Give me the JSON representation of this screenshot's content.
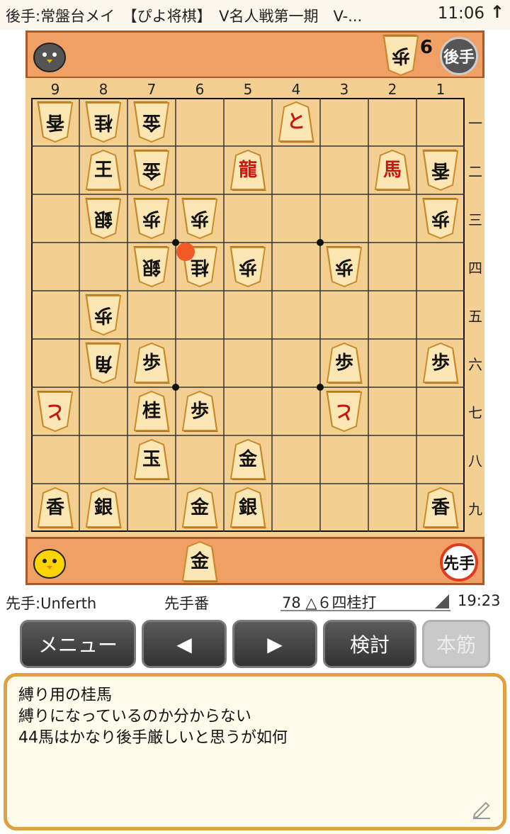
{
  "status_bar": {
    "title": "後手:常盤台メイ　【ぴよ将棋】　V名人戦第一期　V-...",
    "time": "11:06",
    "icon": "up-arrow-icon"
  },
  "gote_hand": {
    "side_label": "後手",
    "pieces": [
      {
        "kind": "歩",
        "count": "6"
      }
    ]
  },
  "sente_hand": {
    "side_label": "先手",
    "pieces": [
      {
        "kind": "金",
        "count": ""
      }
    ]
  },
  "board": {
    "files": [
      "9",
      "8",
      "7",
      "6",
      "5",
      "4",
      "3",
      "2",
      "1"
    ],
    "ranks": [
      "一",
      "二",
      "三",
      "四",
      "五",
      "六",
      "七",
      "八",
      "九"
    ],
    "last_move_square": {
      "file": 6,
      "rank": 4
    },
    "pieces": [
      {
        "file": 9,
        "rank": 1,
        "char": "香",
        "owner": "gote",
        "promoted": false
      },
      {
        "file": 8,
        "rank": 1,
        "char": "桂",
        "owner": "gote",
        "promoted": false
      },
      {
        "file": 7,
        "rank": 1,
        "char": "金",
        "owner": "gote",
        "promoted": false
      },
      {
        "file": 4,
        "rank": 1,
        "char": "と",
        "owner": "sente",
        "promoted": true
      },
      {
        "file": 8,
        "rank": 2,
        "char": "王",
        "owner": "sente",
        "promoted": false
      },
      {
        "file": 7,
        "rank": 2,
        "char": "金",
        "owner": "gote",
        "promoted": false
      },
      {
        "file": 5,
        "rank": 2,
        "char": "龍",
        "owner": "sente",
        "promoted": true
      },
      {
        "file": 2,
        "rank": 2,
        "char": "馬",
        "owner": "sente",
        "promoted": true
      },
      {
        "file": 1,
        "rank": 2,
        "char": "香",
        "owner": "gote",
        "promoted": false
      },
      {
        "file": 8,
        "rank": 3,
        "char": "銀",
        "owner": "gote",
        "promoted": false
      },
      {
        "file": 7,
        "rank": 3,
        "char": "歩",
        "owner": "gote",
        "promoted": false
      },
      {
        "file": 6,
        "rank": 3,
        "char": "歩",
        "owner": "gote",
        "promoted": false
      },
      {
        "file": 1,
        "rank": 3,
        "char": "歩",
        "owner": "gote",
        "promoted": false
      },
      {
        "file": 7,
        "rank": 4,
        "char": "銀",
        "owner": "gote",
        "promoted": false
      },
      {
        "file": 6,
        "rank": 4,
        "char": "桂",
        "owner": "gote",
        "promoted": false
      },
      {
        "file": 5,
        "rank": 4,
        "char": "歩",
        "owner": "gote",
        "promoted": false
      },
      {
        "file": 3,
        "rank": 4,
        "char": "歩",
        "owner": "gote",
        "promoted": false
      },
      {
        "file": 8,
        "rank": 5,
        "char": "歩",
        "owner": "gote",
        "promoted": false
      },
      {
        "file": 8,
        "rank": 6,
        "char": "角",
        "owner": "gote",
        "promoted": false
      },
      {
        "file": 7,
        "rank": 6,
        "char": "歩",
        "owner": "sente",
        "promoted": false
      },
      {
        "file": 3,
        "rank": 6,
        "char": "歩",
        "owner": "sente",
        "promoted": false
      },
      {
        "file": 1,
        "rank": 6,
        "char": "歩",
        "owner": "sente",
        "promoted": false
      },
      {
        "file": 9,
        "rank": 7,
        "char": "と",
        "owner": "gote",
        "promoted": true
      },
      {
        "file": 7,
        "rank": 7,
        "char": "桂",
        "owner": "sente",
        "promoted": false
      },
      {
        "file": 6,
        "rank": 7,
        "char": "歩",
        "owner": "sente",
        "promoted": false
      },
      {
        "file": 3,
        "rank": 7,
        "char": "と",
        "owner": "gote",
        "promoted": true
      },
      {
        "file": 7,
        "rank": 8,
        "char": "玉",
        "owner": "sente",
        "promoted": false
      },
      {
        "file": 5,
        "rank": 8,
        "char": "金",
        "owner": "sente",
        "promoted": false
      },
      {
        "file": 9,
        "rank": 9,
        "char": "香",
        "owner": "sente",
        "promoted": false
      },
      {
        "file": 8,
        "rank": 9,
        "char": "銀",
        "owner": "sente",
        "promoted": false
      },
      {
        "file": 6,
        "rank": 9,
        "char": "金",
        "owner": "sente",
        "promoted": false
      },
      {
        "file": 5,
        "rank": 9,
        "char": "銀",
        "owner": "sente",
        "promoted": false
      },
      {
        "file": 1,
        "rank": 9,
        "char": "香",
        "owner": "sente",
        "promoted": false
      }
    ]
  },
  "info": {
    "sente_player": "先手:Unferth",
    "turn": "先手番",
    "move": "78 △６四桂打",
    "clock": "19:23"
  },
  "buttons": {
    "menu": "メニュー",
    "prev": "◀",
    "next": "▶",
    "analyze": "検討",
    "mainline": "本筋"
  },
  "comment": {
    "lines": [
      "縛り用の桂馬",
      "縛りになっているのか分からない",
      "44馬はかなり後手厳しいと思うが如何"
    ],
    "icon": "pencil-edit-icon"
  },
  "colors": {
    "board": "#f4cf92",
    "hand": "#f0a064",
    "accent": "#e0a040",
    "promoted": "#c8170f",
    "last_move": "#f05a24"
  }
}
